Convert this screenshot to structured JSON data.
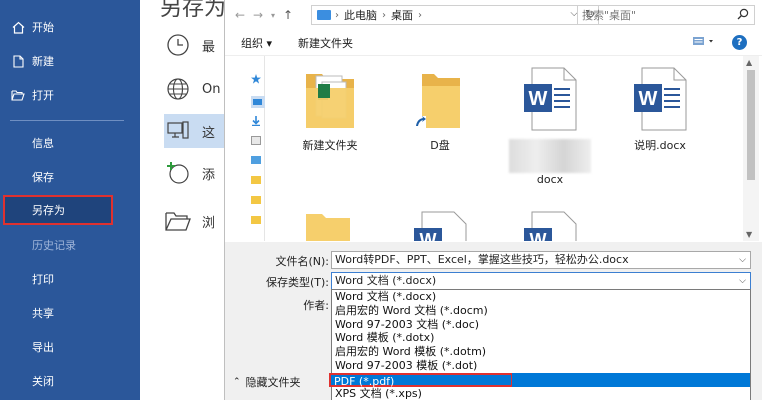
{
  "sidebar": {
    "items": [
      {
        "label": "开始",
        "icon": "home-icon"
      },
      {
        "label": "新建",
        "icon": "new-document-icon"
      },
      {
        "label": "打开",
        "icon": "folder-open-icon"
      },
      {
        "label": "信息"
      },
      {
        "label": "保存"
      },
      {
        "label": "另存为"
      },
      {
        "label": "历史记录"
      },
      {
        "label": "打印"
      },
      {
        "label": "共享"
      },
      {
        "label": "导出"
      },
      {
        "label": "关闭"
      }
    ]
  },
  "backstage": {
    "title_fragment": "另存为",
    "locations": [
      {
        "label": "最",
        "icon": "clock-icon"
      },
      {
        "label": "On",
        "icon": "globe-icon"
      },
      {
        "label": "这",
        "icon": "this-pc-icon"
      },
      {
        "label": "添",
        "icon": "add-place-icon"
      },
      {
        "label": "浏",
        "icon": "browse-folder-icon"
      }
    ]
  },
  "dialog": {
    "breadcrumb": [
      "此电脑",
      "桌面"
    ],
    "search_placeholder": "搜索\"桌面\"",
    "toolbar": {
      "organize": "组织 ▾",
      "new_folder": "新建文件夹"
    },
    "files": [
      {
        "name": "新建文件夹",
        "type": "folder-excel"
      },
      {
        "name": "D盘",
        "type": "folder-shortcut"
      },
      {
        "name_line1": "        ",
        "name_line2": "docx",
        "type": "word"
      },
      {
        "name": "说明.docx",
        "type": "word"
      }
    ],
    "filename_label": "文件名(N):",
    "filename_value": "Word转PDF、PPT、Excel，掌握这些技巧，轻松办公.docx",
    "filetype_label": "保存类型(T):",
    "filetype_value": "Word 文档 (*.docx)",
    "author_label": "作者:",
    "filetype_options": [
      "Word 文档 (*.docx)",
      "启用宏的 Word 文档 (*.docm)",
      "Word 97-2003 文档 (*.doc)",
      "Word 模板 (*.dotx)",
      "启用宏的 Word 模板 (*.dotm)",
      "Word 97-2003 模板 (*.dot)",
      "PDF (*.pdf)",
      "XPS 文档 (*.xps)"
    ],
    "hide_folders": "隐藏文件夹",
    "colors": {
      "accent": "#2b579a",
      "highlight": "#0078d7",
      "callout": "#e0312f"
    }
  }
}
